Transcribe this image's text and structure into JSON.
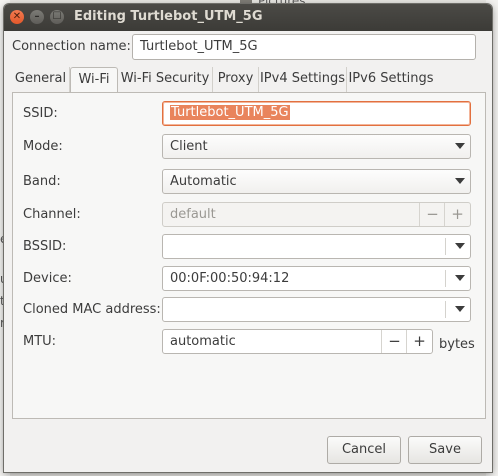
{
  "background": {
    "pictures_label": "Pictures",
    "left_chars": [
      "e",
      "u",
      "t",
      "r"
    ]
  },
  "window": {
    "title": "Editing Turtlebot_UTM_5G",
    "close_glyph": "✕",
    "min_glyph": "–",
    "max_glyph": "☐"
  },
  "connection": {
    "label": "Connection name:",
    "value": "Turtlebot_UTM_5G"
  },
  "tabs": [
    {
      "label": "General"
    },
    {
      "label": "Wi-Fi"
    },
    {
      "label": "Wi-Fi Security"
    },
    {
      "label": "Proxy"
    },
    {
      "label": "IPv4 Settings"
    },
    {
      "label": "IPv6 Settings"
    }
  ],
  "active_tab": "Wi-Fi",
  "wifi": {
    "ssid": {
      "label": "SSID:",
      "value": "Turtlebot_UTM_5G"
    },
    "mode": {
      "label": "Mode:",
      "value": "Client"
    },
    "band": {
      "label": "Band:",
      "value": "Automatic"
    },
    "channel": {
      "label": "Channel:",
      "value": "default",
      "minus": "−",
      "plus": "+"
    },
    "bssid": {
      "label": "BSSID:",
      "value": ""
    },
    "device": {
      "label": "Device:",
      "value": "00:0F:00:50:94:12"
    },
    "cloned_mac": {
      "label": "Cloned MAC address:",
      "value": ""
    },
    "mtu": {
      "label": "MTU:",
      "value": "automatic",
      "minus": "−",
      "plus": "+",
      "unit": "bytes"
    }
  },
  "buttons": {
    "cancel": "Cancel",
    "save": "Save"
  },
  "colors": {
    "accent": "#e9845c",
    "titlebar": "#3c3b37",
    "close": "#e2582b"
  }
}
